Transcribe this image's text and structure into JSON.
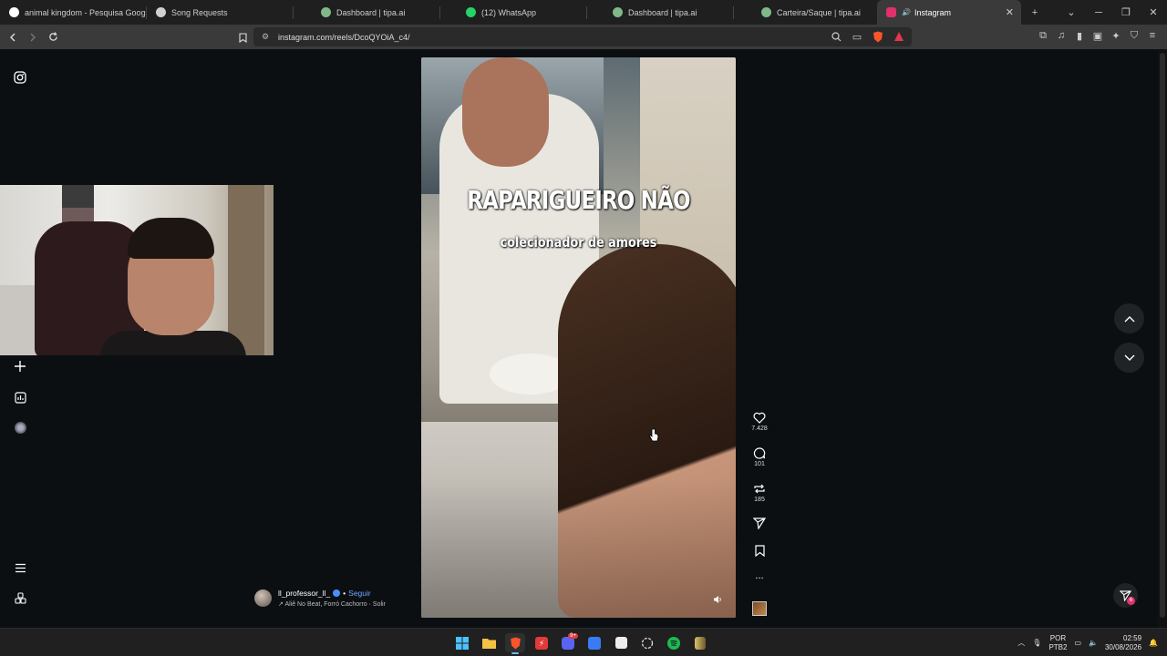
{
  "browser": {
    "tabs": [
      {
        "title": "animal kingdom - Pesquisa Google",
        "icon": "google-icon",
        "color": "#ffffff"
      },
      {
        "title": "Song Requests",
        "icon": "song-requests-icon",
        "color": "#d0d0d0"
      },
      {
        "title": "Dashboard | tipa.ai",
        "icon": "tipa-icon",
        "color": "#7fb98a"
      },
      {
        "title": "(12) WhatsApp",
        "icon": "whatsapp-icon",
        "color": "#25d366"
      },
      {
        "title": "Dashboard | tipa.ai",
        "icon": "tipa-icon",
        "color": "#7fb98a"
      },
      {
        "title": "Carteira/Saque | tipa.ai",
        "icon": "tipa-icon",
        "color": "#7fb98a"
      },
      {
        "title": "Instagram",
        "icon": "instagram-icon",
        "color": "#e1306c",
        "active": true
      }
    ],
    "new_tab": "+",
    "url": "instagram.com/reels/DcoQYOiA_c4/"
  },
  "reel": {
    "overlay_title": "RAPARIGUEIRO NÃO",
    "overlay_subtitle": "colecionador de amores",
    "author": "ll_professor_ll_",
    "follow_label": "Seguir",
    "separator": "•",
    "audio": "Aliê No Beat, Forró Cachorro · Solir",
    "likes": "7.428",
    "comments": "101",
    "reposts": "185",
    "more": "..."
  },
  "filter_badge": "6",
  "taskbar": {
    "apps": [
      "windows-start-icon",
      "file-explorer-icon",
      "brave-icon",
      "app-red-icon",
      "discord-icon",
      "app-blue-icon",
      "app-white-icon",
      "chatgpt-icon",
      "spotify-icon",
      "app-yellow-icon"
    ],
    "discord_badge": "9+",
    "lang_top": "POR",
    "lang_bottom": "PTB2",
    "time": "02:59",
    "date": "30/08/2026"
  },
  "colors": {
    "instagram_accent": "#e1306c",
    "follow_blue": "#6ea5ff",
    "page_bg": "#0c0f12"
  }
}
